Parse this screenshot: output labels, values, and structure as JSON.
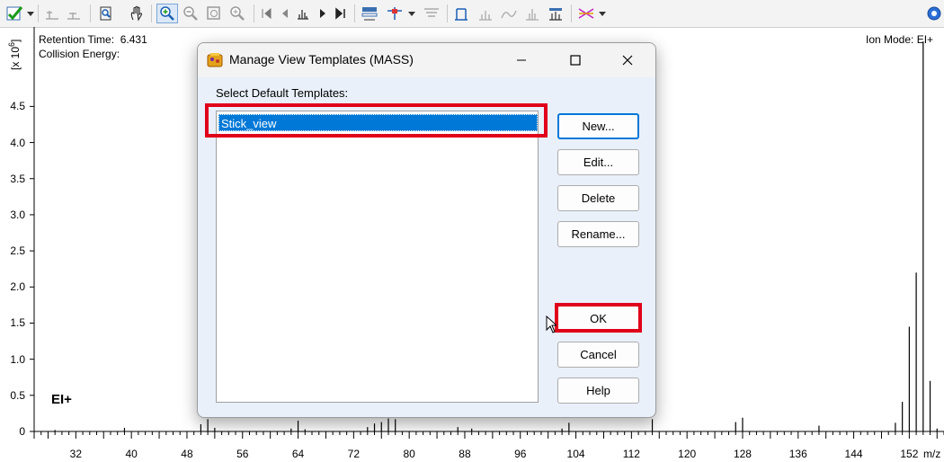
{
  "toolbar": {
    "icons": [
      "chart-check-icon",
      "dropdown-icon",
      "peak-add-icon",
      "peak-remove-icon",
      "library-search-icon",
      "pan-hand-icon",
      "zoom-in-icon",
      "zoom-out-icon",
      "zoom-fit-icon",
      "zoom-reset-icon",
      "first-scan-icon",
      "previous-scan-icon",
      "spectrum-icon",
      "next-scan-icon",
      "last-scan-icon",
      "display-settings-icon",
      "marker-icon",
      "dropdown-icon",
      "clear-icon",
      "peak-label-icon",
      "mass-label-icon",
      "noise-icon",
      "ion-label-icon",
      "template-icon",
      "scheme-icon",
      "help-icon"
    ]
  },
  "spectrum": {
    "retention_label": "Retention Time:",
    "retention_value": "6.431",
    "collision_label": "Collision Energy:",
    "ion_mode": "Ion Mode: EI+",
    "ionization": "EI+",
    "y_unit": "[x 10",
    "y_exp": "6",
    "y_close": "]",
    "y_ticks": [
      "4.5",
      "4.0",
      "3.5",
      "3.0",
      "2.5",
      "2.0",
      "1.5",
      "1.0",
      "0.5",
      "0"
    ],
    "x_ticks": [
      "32",
      "40",
      "48",
      "56",
      "64",
      "72",
      "80",
      "88",
      "96",
      "104",
      "112",
      "120",
      "128",
      "136",
      "144",
      "152"
    ],
    "x_unit": "m/z"
  },
  "chart_data": {
    "type": "bar",
    "xlabel": "m/z",
    "ylabel": "[x 10^6]",
    "xlim": [
      26,
      157
    ],
    "ylim": [
      0,
      5.6
    ],
    "peaks": [
      {
        "mz": 29,
        "i": 0.02
      },
      {
        "mz": 39,
        "i": 0.05
      },
      {
        "mz": 50,
        "i": 0.1
      },
      {
        "mz": 51,
        "i": 0.17
      },
      {
        "mz": 52,
        "i": 0.05
      },
      {
        "mz": 63,
        "i": 0.04
      },
      {
        "mz": 64,
        "i": 0.15
      },
      {
        "mz": 65,
        "i": 0.03
      },
      {
        "mz": 74,
        "i": 0.06
      },
      {
        "mz": 75,
        "i": 0.11
      },
      {
        "mz": 76,
        "i": 0.13
      },
      {
        "mz": 77,
        "i": 0.18
      },
      {
        "mz": 78,
        "i": 0.17
      },
      {
        "mz": 87,
        "i": 0.06
      },
      {
        "mz": 89,
        "i": 0.04
      },
      {
        "mz": 102,
        "i": 0.04
      },
      {
        "mz": 103,
        "i": 0.12
      },
      {
        "mz": 115,
        "i": 0.17
      },
      {
        "mz": 127,
        "i": 0.13
      },
      {
        "mz": 128,
        "i": 0.19
      },
      {
        "mz": 139,
        "i": 0.08
      },
      {
        "mz": 150,
        "i": 0.12
      },
      {
        "mz": 151,
        "i": 0.41
      },
      {
        "mz": 152,
        "i": 1.45
      },
      {
        "mz": 153,
        "i": 2.2
      },
      {
        "mz": 154,
        "i": 5.4
      },
      {
        "mz": 155,
        "i": 0.7
      },
      {
        "mz": 156,
        "i": 0.04
      }
    ]
  },
  "dialog": {
    "title": "Manage View Templates (MASS)",
    "select_label": "Select Default Templates:",
    "templates": [
      "Stick_view"
    ],
    "selected_template": "Stick_view",
    "buttons": {
      "new": "New...",
      "edit": "Edit...",
      "delete": "Delete",
      "rename": "Rename...",
      "ok": "OK",
      "cancel": "Cancel",
      "help": "Help"
    },
    "highlight_color": "#e0001a",
    "selection_color": "#0078d7"
  }
}
